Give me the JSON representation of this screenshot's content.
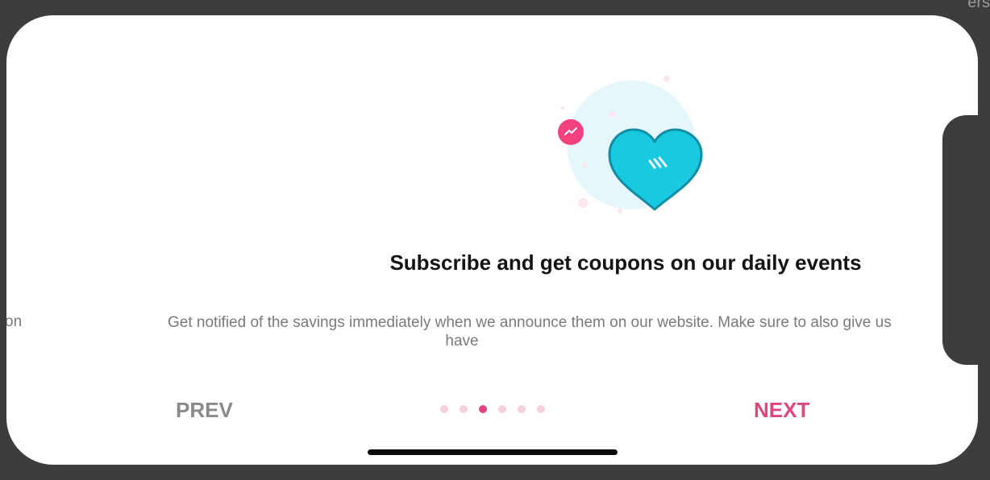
{
  "corner_fragment": "ers",
  "onboarding": {
    "title": "Subscribe and get coupons on our daily events",
    "description_line1": "Get notified of the savings immediately when we announce them on our website. Make sure to also give us",
    "description_line2": "have",
    "offscreen_fragment": "on",
    "prev_label": "PREV",
    "next_label": "NEXT",
    "page_indicator": {
      "total": 6,
      "active_index": 2
    }
  },
  "colors": {
    "accent": "#e0457e",
    "heart": "#18c9e0",
    "circle": "#e6f7fb",
    "inactive_dot": "#f6cfdc"
  }
}
